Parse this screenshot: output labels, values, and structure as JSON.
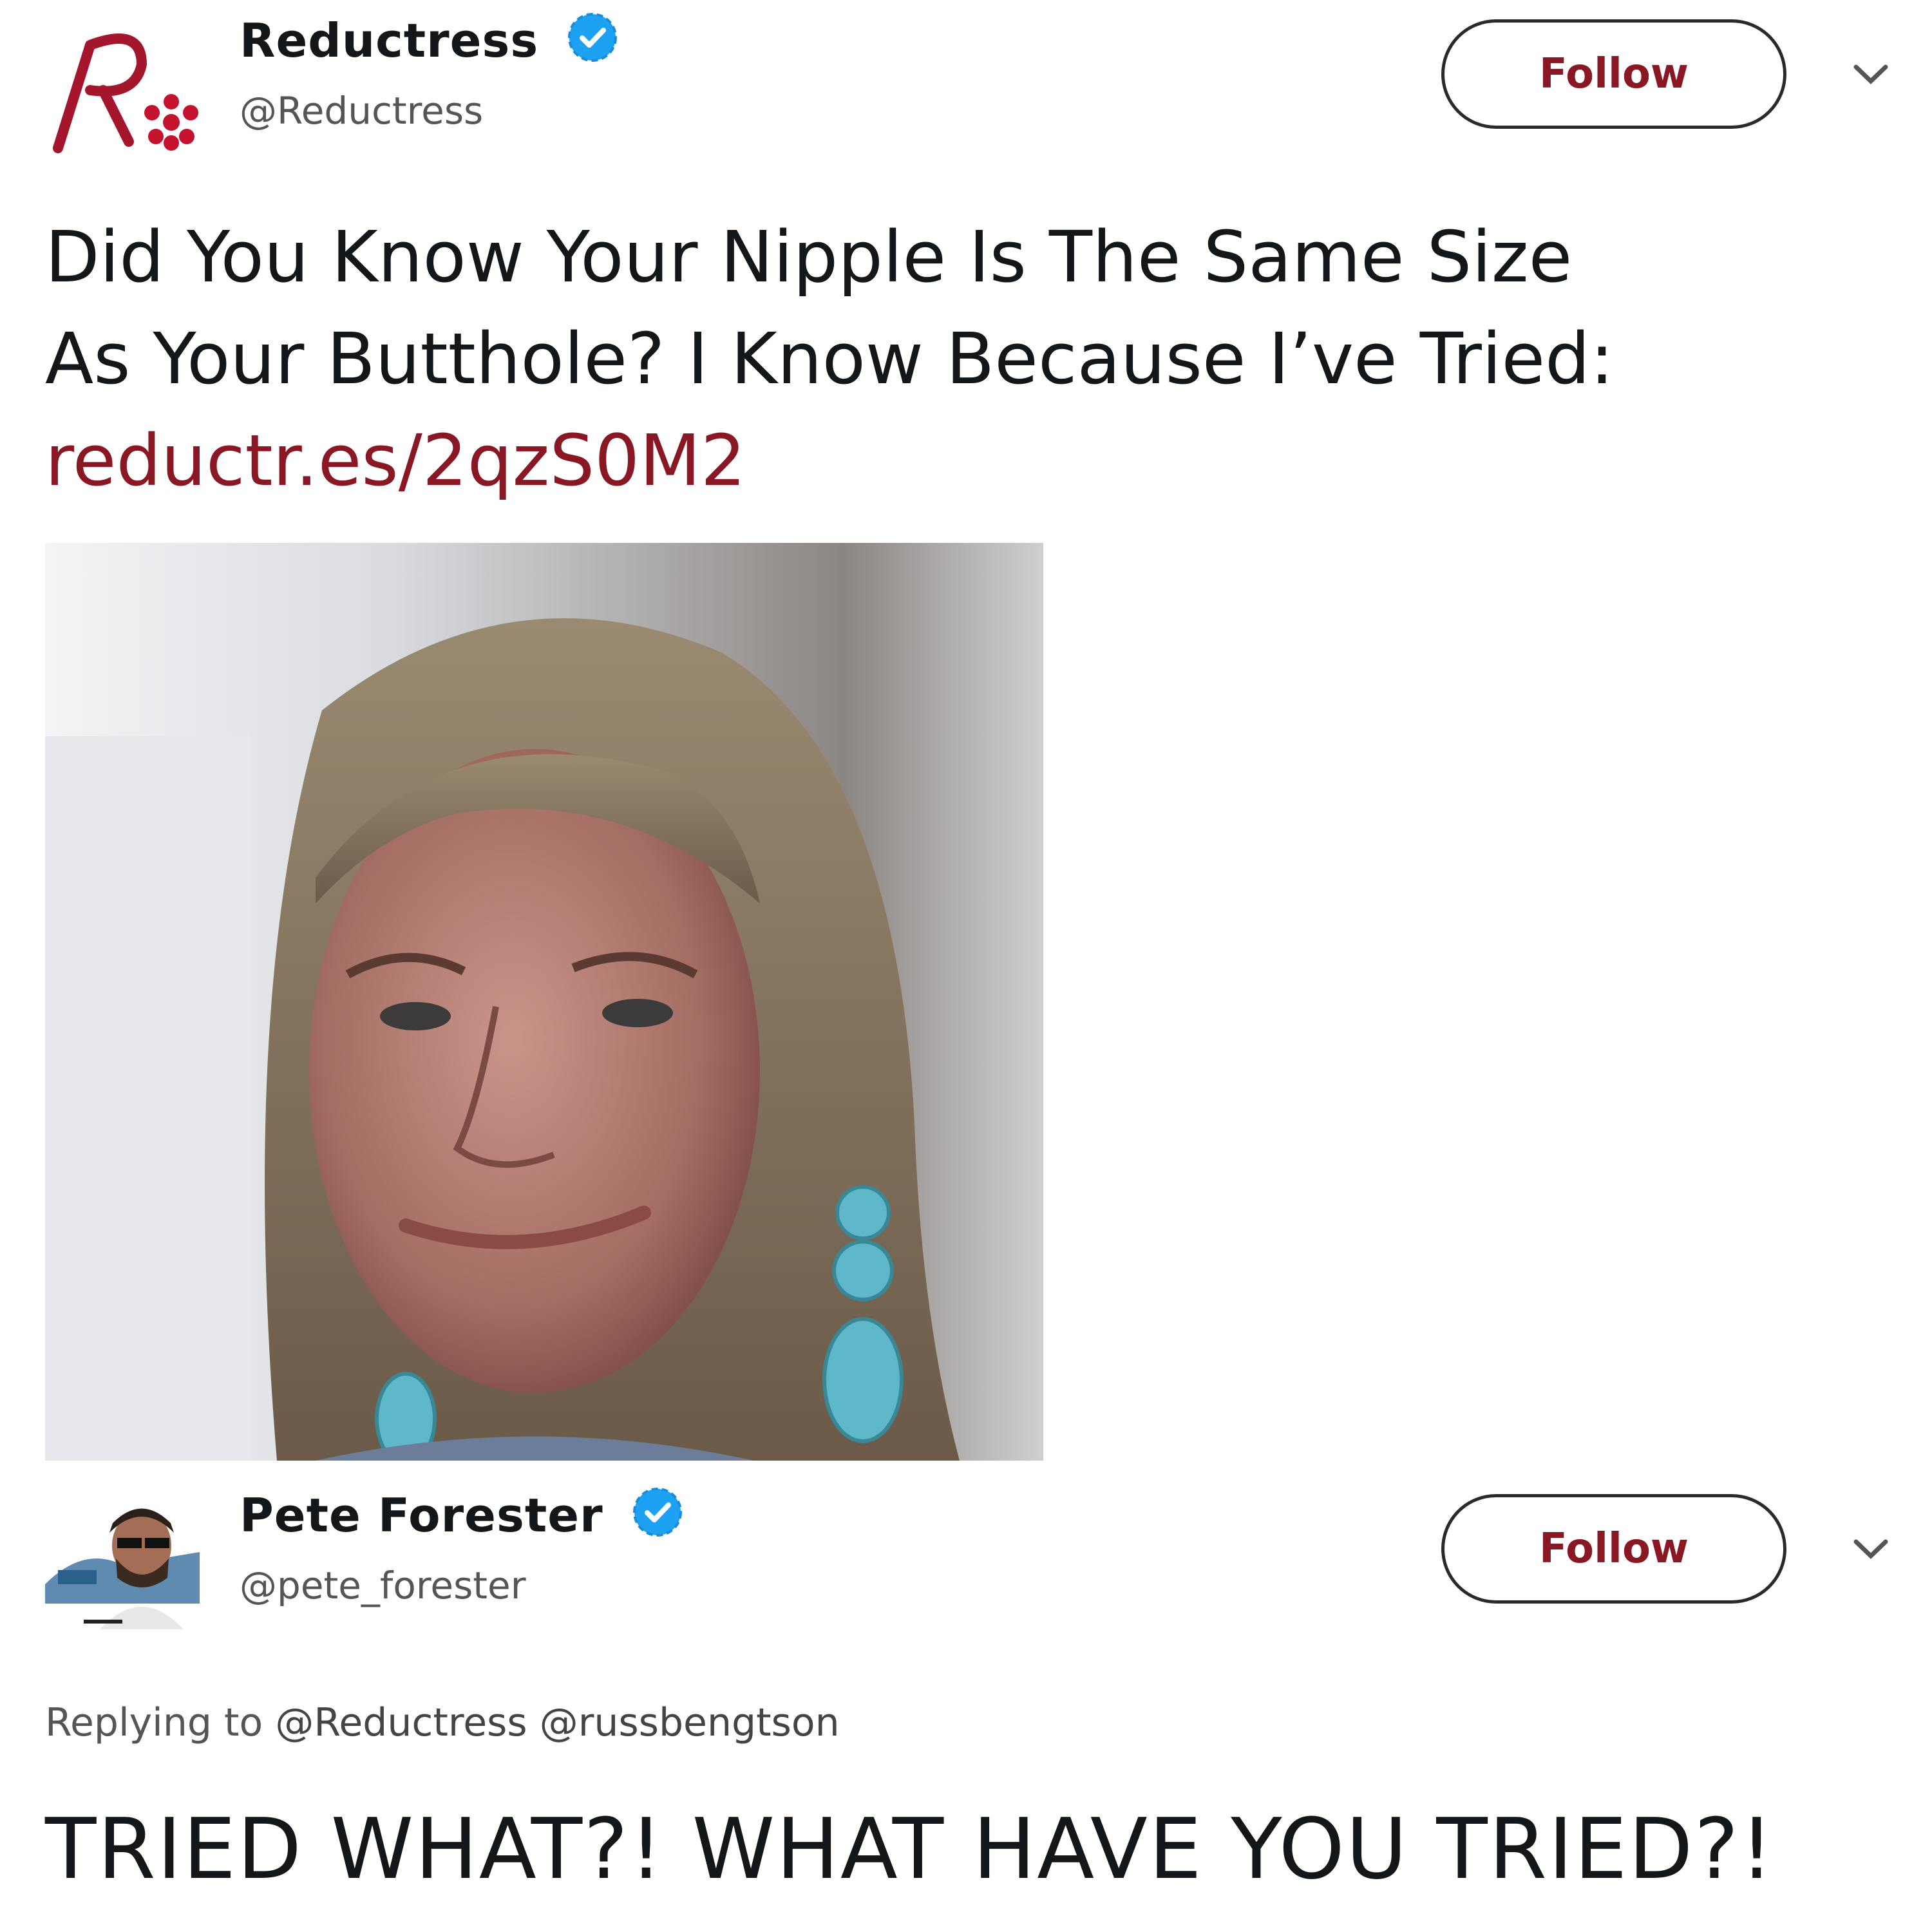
{
  "tweets": [
    {
      "author": {
        "name": "Reductress",
        "handle": "@Reductress",
        "verified": true,
        "avatar_icon": "reductress-logo-icon"
      },
      "follow_label": "Follow",
      "text_lines": [
        "Did You Know Your Nipple Is The Same Size",
        "As Your Butthole? I Know Because I’ve Tried:"
      ],
      "link": "reductr.es/2qzS0M2",
      "media": {
        "type": "photo",
        "icon": "portrait-photo"
      }
    },
    {
      "author": {
        "name": "Pete Forester",
        "handle": "@pete_forester",
        "verified": true,
        "avatar_icon": "user-avatar-icon"
      },
      "follow_label": "Follow",
      "replying_prefix": "Replying to",
      "replying_to": [
        "@Reductress",
        "@russbengtson"
      ],
      "text": "TRIED WHAT?! WHAT HAVE YOU TRIED?!"
    }
  ],
  "colors": {
    "brand_red": "#8a1824",
    "verified_blue": "#1da1f2",
    "text": "#14171a",
    "secondary_text": "#555555"
  }
}
